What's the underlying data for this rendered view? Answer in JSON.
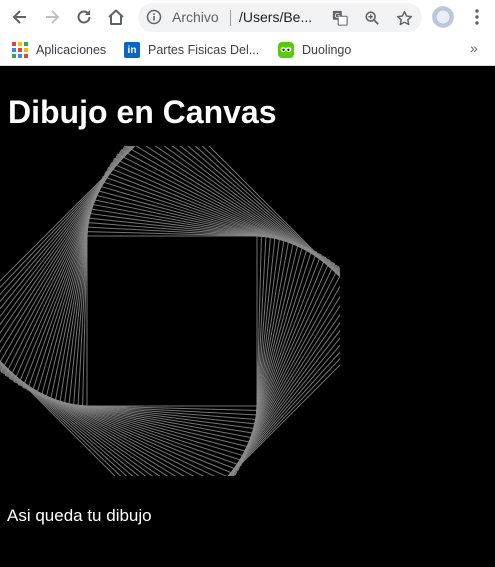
{
  "browser": {
    "scheme_label": "Archivo",
    "url_text": "/Users/Be...",
    "icons": {
      "back": "arrow-left-icon",
      "forward": "arrow-right-icon",
      "reload": "reload-icon",
      "home": "home-icon",
      "info": "info-icon",
      "translate": "translate-icon",
      "zoom": "zoom-icon",
      "bookmark": "star-icon",
      "profile": "avatar",
      "menu": "kebab-menu-icon"
    }
  },
  "bookmarks": [
    {
      "label": "Aplicaciones",
      "icon": "apps-grid-icon"
    },
    {
      "label": "Partes Fisicas Del...",
      "icon": "linkedin-icon"
    },
    {
      "label": "Duolingo",
      "icon": "duolingo-icon"
    }
  ],
  "bookmarks_more": "»",
  "page": {
    "title": "Dibujo en Canvas",
    "caption": "Asi queda tu dibujo"
  },
  "colors": {
    "page_background": "#000000",
    "stroke": "#8a8a8a",
    "text": "#ffffff"
  }
}
